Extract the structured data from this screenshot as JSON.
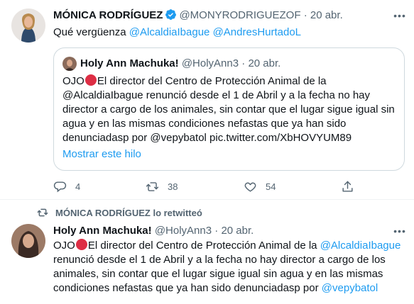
{
  "tweet1": {
    "author_name": "MÓNICA RODRÍGUEZ",
    "author_handle": "@MONYRODRIGUEZOF",
    "separator": "·",
    "time": "20 abr.",
    "text_prefix": "Qué vergüenza ",
    "mention1": "@AlcaldiaIbague",
    "mention2": "@AndresHurtadoL",
    "quote": {
      "author_name": "Holy Ann Machuka!",
      "author_handle": "@HolyAnn3",
      "separator": "·",
      "time": "20 abr.",
      "text_start": "OJO",
      "text_rest": "El director del Centro de Protección Animal de la @AlcaldiaIbague renunció desde el 1 de Abril y a la fecha no hay director a cargo de los animales, sin contar que el lugar sigue igual sin agua y en las mismas condiciones nefastas que ya han sido denunciadasp por @vepybatol pic.twitter.com/XbHOVYUM89",
      "show_more": "Mostrar este hilo"
    },
    "actions": {
      "replies": "4",
      "retweets": "38",
      "likes": "54"
    },
    "icons": [
      "verified-badge-icon",
      "more-icon",
      "reply-icon",
      "retweet-icon",
      "like-icon",
      "share-icon"
    ]
  },
  "tweet2": {
    "retweeted_by": "MÓNICA RODRÍGUEZ lo retwitteó",
    "author_name": "Holy Ann Machuka!",
    "author_handle": "@HolyAnn3",
    "separator": "·",
    "time": "20 abr.",
    "text_start": "OJO",
    "text_mid": "El director del Centro de Protección Animal de la ",
    "mention1": "@AlcaldiaIbague",
    "text_rest": " renunció desde el 1 de Abril y a la fecha no hay director a cargo de los animales, sin contar que el lugar sigue igual sin agua y en las mismas condiciones nefastas que ya han sido denunciadasp por ",
    "mention2": "@vepybatol"
  },
  "colors": {
    "accent": "#1d9bf0",
    "secondary_text": "#536471",
    "border": "#cfd9de",
    "emoji_red": "#dd2e44"
  }
}
